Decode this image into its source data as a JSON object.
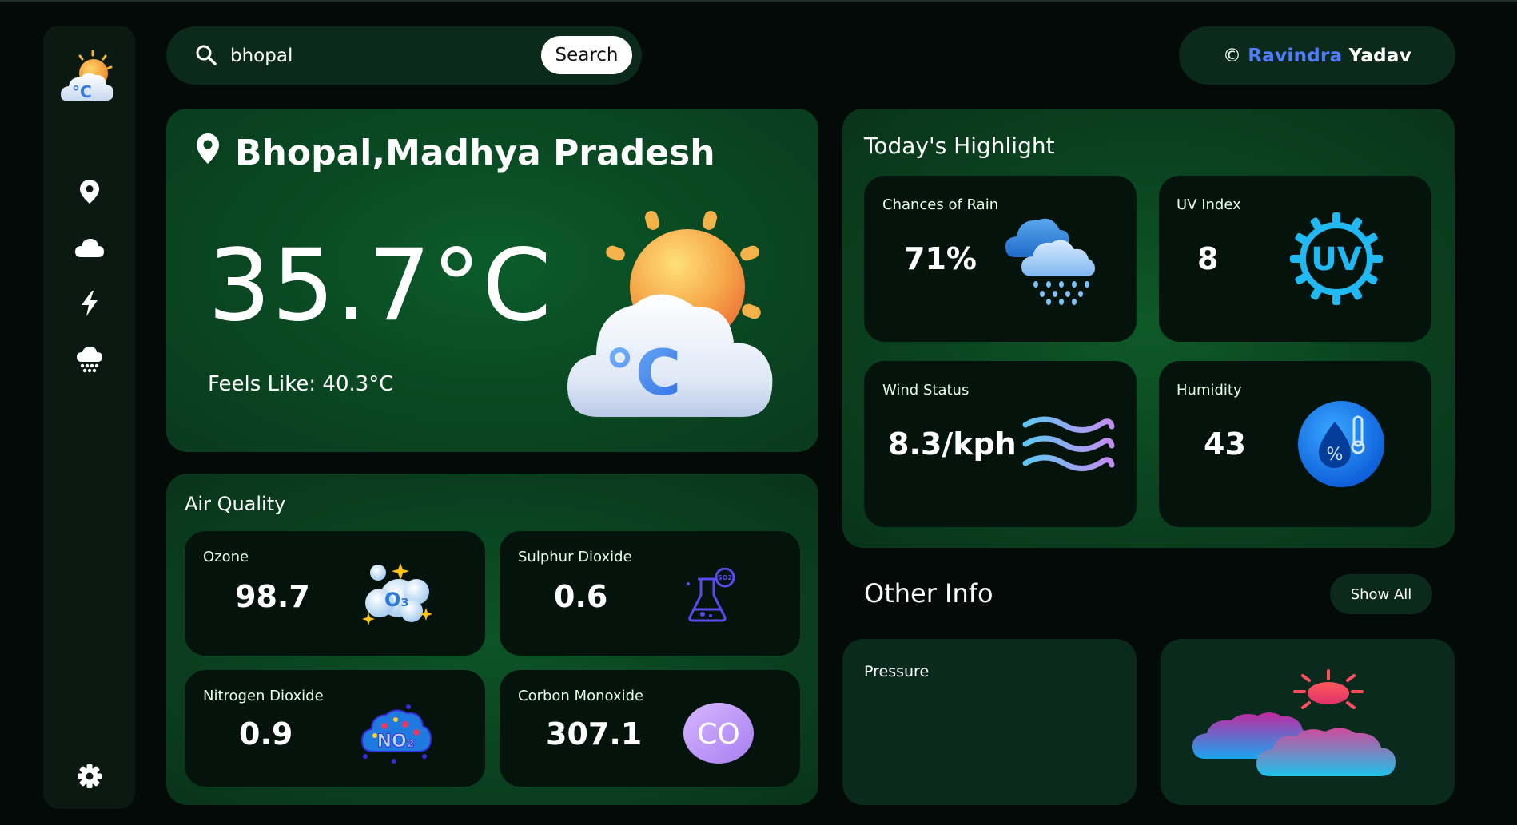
{
  "search": {
    "value": "bhopal",
    "button_label": "Search"
  },
  "credit": {
    "symbol": "©",
    "first_name": "Ravindra",
    "last_name": "Yadav"
  },
  "current": {
    "city": "Bhopal,Madhya Pradesh",
    "temperature": "35.7°C",
    "feels_like": "Feels Like: 40.3°C"
  },
  "highlights": {
    "title": "Today's Highlight",
    "rain": {
      "label": "Chances of Rain",
      "value": "71%"
    },
    "uv": {
      "label": "UV Index",
      "value": "8"
    },
    "wind": {
      "label": "Wind Status",
      "value": "8.3/kph"
    },
    "humidity": {
      "label": "Humidity",
      "value": "43"
    }
  },
  "air_quality": {
    "title": "Air Quality",
    "ozone": {
      "label": "Ozone",
      "value": "98.7"
    },
    "so2": {
      "label": "Sulphur Dioxide",
      "value": "0.6"
    },
    "no2": {
      "label": "Nitrogen Dioxide",
      "value": "0.9"
    },
    "co": {
      "label": "Corbon Monoxide",
      "value": "307.1",
      "badge": "CO"
    }
  },
  "other_info": {
    "title": "Other Info",
    "show_all_label": "Show All",
    "pressure_label": "Pressure"
  },
  "icon_texts": {
    "logo": "°C",
    "main": "°C",
    "uv": "UV",
    "ozone": "O₃",
    "so2": "SO2",
    "no2": "NO₂",
    "humidity": "%"
  },
  "icons": {
    "sidebar": [
      "location-pin-icon",
      "cloud-icon",
      "lightning-icon",
      "rain-cloud-icon",
      "gear-icon"
    ]
  },
  "colors": {
    "background": "#040a07",
    "card": "#0a4420",
    "tile": "#04140d",
    "accent_blue": "#4f7dff"
  }
}
